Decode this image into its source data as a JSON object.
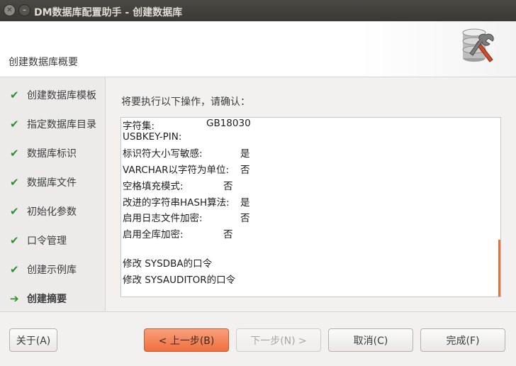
{
  "window": {
    "title": "DM数据库配置助手 - 创建数据库",
    "close_glyph": "✕",
    "minimize_glyph": "–"
  },
  "header": {
    "title": "创建数据库概要"
  },
  "sidebar": {
    "steps": [
      {
        "label": "创建数据库模板",
        "state": "done"
      },
      {
        "label": "指定数据库目录",
        "state": "done"
      },
      {
        "label": "数据库标识",
        "state": "done"
      },
      {
        "label": "数据库文件",
        "state": "done"
      },
      {
        "label": "初始化参数",
        "state": "done"
      },
      {
        "label": "口令管理",
        "state": "done"
      },
      {
        "label": "创建示例库",
        "state": "done"
      },
      {
        "label": "创建摘要",
        "state": "current"
      }
    ],
    "icons": {
      "done": "✔",
      "current": "➔"
    }
  },
  "main": {
    "prompt": "将要执行以下操作，请确认：",
    "summary_lines": [
      {
        "label": "字符集:",
        "value": "GB18030"
      },
      {
        "label": "USBKEY-PIN:",
        "value": ""
      },
      {
        "label": "标识符大小写敏感:",
        "value": "是"
      },
      {
        "label": "VARCHAR以字符为单位:",
        "value": "否"
      },
      {
        "label": "空格填充模式:",
        "value": "否"
      },
      {
        "label": "改进的字符串HASH算法:",
        "value": "是"
      },
      {
        "label": "启用日志文件加密:",
        "value": "否"
      },
      {
        "label": "启用全库加密:",
        "value": "否"
      }
    ],
    "actions": [
      "修改 SYSDBA的口令",
      "修改 SYSAUDITOR的口令"
    ]
  },
  "footer": {
    "about_label": "关于(A)",
    "back_label": "< 上一步(B)",
    "next_label": "下一步(N) >",
    "cancel_label": "取消(C)",
    "finish_label": "完成(F)"
  },
  "colors": {
    "accent": "#ef6f3e",
    "check_green": "#2e8f2e",
    "titlebar": "#3f3e3a"
  }
}
